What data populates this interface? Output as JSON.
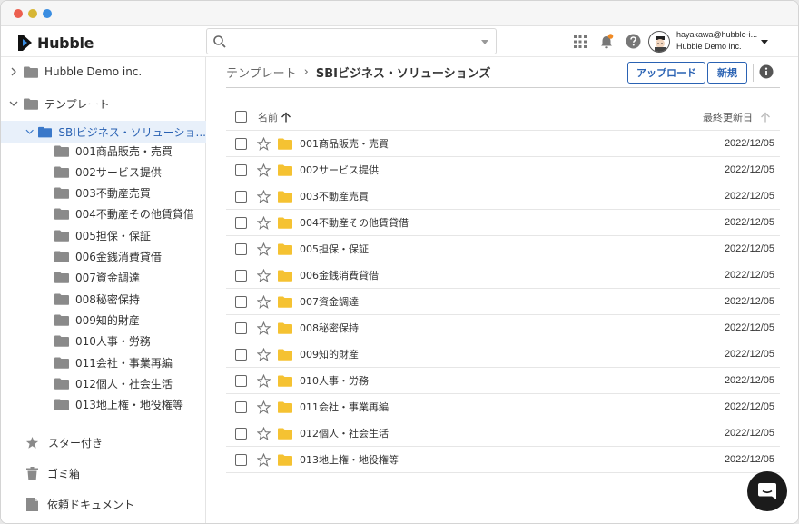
{
  "app": {
    "name": "Hubble"
  },
  "search": {
    "placeholder": "",
    "value": ""
  },
  "user": {
    "email": "hayakawa@hubble-i...",
    "org": "Hubble Demo inc."
  },
  "colors": {
    "accent": "#2a62b3",
    "folder_gray": "#8a8a8a",
    "folder_blue": "#3a78c9",
    "folder_yellow": "#f5c232",
    "notify": "#f08a24"
  },
  "sidebar": {
    "root": "Hubble Demo inc.",
    "templates": "テンプレート",
    "selected": "SBIビジネス・ソリューショ...",
    "folders": [
      "001商品販売・売買",
      "002サービス提供",
      "003不動産売買",
      "004不動産その他賃貸借",
      "005担保・保証",
      "006金銭消費貸借",
      "007資金調達",
      "008秘密保持",
      "009知的財産",
      "010人事・労務",
      "011会社・事業再編",
      "012個人・社会生活",
      "013地上権・地役権等"
    ],
    "nav": {
      "starred": "スター付き",
      "trash": "ゴミ箱",
      "requests": "依頼ドキュメント"
    }
  },
  "main": {
    "breadcrumb": {
      "parent": "テンプレート",
      "current": "SBIビジネス・ソリューションズ"
    },
    "upload_label": "アップロード",
    "new_label": "新規",
    "columns": {
      "name": "名前",
      "updated": "最終更新日"
    },
    "rows": [
      {
        "name": "001商品販売・売買",
        "date": "2022/12/05"
      },
      {
        "name": "002サービス提供",
        "date": "2022/12/05"
      },
      {
        "name": "003不動産売買",
        "date": "2022/12/05"
      },
      {
        "name": "004不動産その他賃貸借",
        "date": "2022/12/05"
      },
      {
        "name": "005担保・保証",
        "date": "2022/12/05"
      },
      {
        "name": "006金銭消費貸借",
        "date": "2022/12/05"
      },
      {
        "name": "007資金調達",
        "date": "2022/12/05"
      },
      {
        "name": "008秘密保持",
        "date": "2022/12/05"
      },
      {
        "name": "009知的財産",
        "date": "2022/12/05"
      },
      {
        "name": "010人事・労務",
        "date": "2022/12/05"
      },
      {
        "name": "011会社・事業再編",
        "date": "2022/12/05"
      },
      {
        "name": "012個人・社会生活",
        "date": "2022/12/05"
      },
      {
        "name": "013地上権・地役権等",
        "date": "2022/12/05"
      }
    ]
  }
}
